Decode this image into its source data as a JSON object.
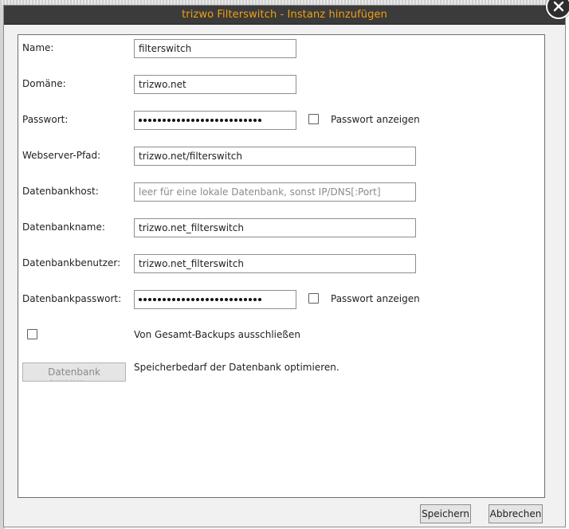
{
  "dialog": {
    "title": "trizwo Filterswitch - Instanz hinzufügen",
    "title_color": "#f0a010"
  },
  "form": {
    "name": {
      "label": "Name:",
      "value": "filterswitch"
    },
    "domain": {
      "label": "Domäne:",
      "value": "trizwo.net"
    },
    "password": {
      "label": "Passwort:",
      "masked_length": 26,
      "show_label": "Passwort anzeigen",
      "show_checked": false
    },
    "webserver_path": {
      "label": "Webserver-Pfad:",
      "value": "trizwo.net/filterswitch"
    },
    "db_host": {
      "label": "Datenbankhost:",
      "value": "",
      "placeholder": "leer für eine lokale Datenbank, sonst IP/DNS[:Port]"
    },
    "db_name": {
      "label": "Datenbankname:",
      "value": "trizwo.net_filterswitch"
    },
    "db_user": {
      "label": "Datenbankbenutzer:",
      "value": "trizwo.net_filterswitch"
    },
    "db_password": {
      "label": "Datenbankpasswort:",
      "masked_length": 26,
      "show_label": "Passwort anzeigen",
      "show_checked": false
    },
    "exclude_backups": {
      "label": "Von Gesamt-Backups ausschließen",
      "checked": false
    },
    "optimize": {
      "button_label": "Datenbank",
      "button_sublabel": "bereinigen",
      "description": "Speicherbedarf der Datenbank optimieren."
    }
  },
  "footer": {
    "save_label": "Speichern",
    "cancel_label": "Abbrechen"
  },
  "icons": {
    "close": "close-icon"
  }
}
